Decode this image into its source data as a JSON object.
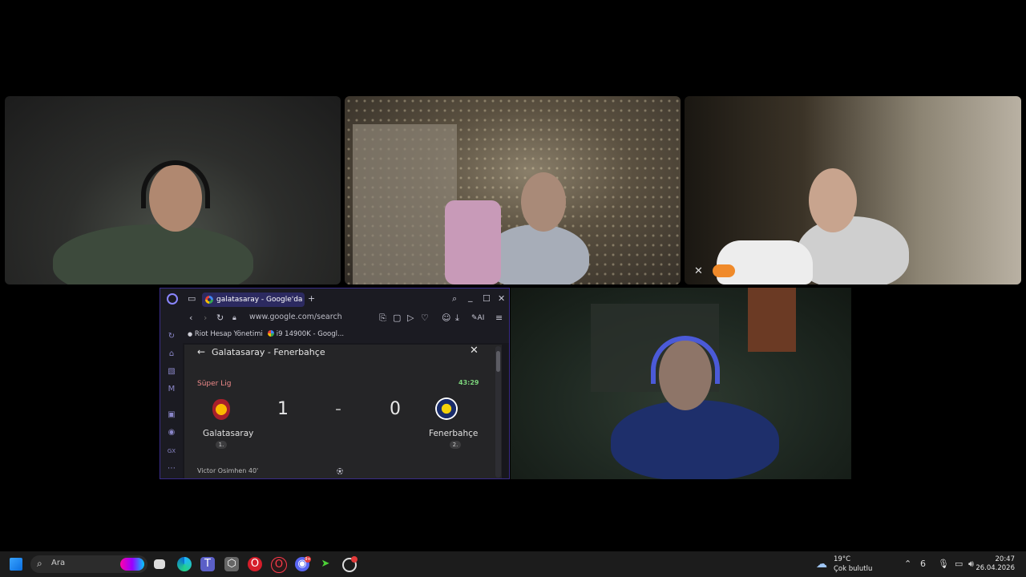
{
  "browser": {
    "tab_title": "galatasaray - Google'da Ara",
    "url": "www.google.com/search",
    "ai_label": "AI",
    "bookmarks": [
      "Riot Hesap Yönetimi",
      "i9 14900K - Googl..."
    ],
    "sidebar_labels": [
      "GX"
    ]
  },
  "match": {
    "title": "Galatasaray - Fenerbahçe",
    "league": "Süper Lig",
    "time": "43:29",
    "home": {
      "name": "Galatasaray",
      "score": "1",
      "rank": "1."
    },
    "away": {
      "name": "Fenerbahçe",
      "score": "0",
      "rank": "2."
    },
    "separator": "-",
    "scorer": "Victor Osimhen 40'"
  },
  "taskbar": {
    "search_placeholder": "Ara",
    "weather_temp": "19°C",
    "weather_desc": "Çok bulutlu",
    "time": "20:47",
    "date": "26.04.2026",
    "discord_badge": "9+"
  },
  "icons": [
    "opera-logo-icon",
    "tab-switch-icon",
    "search-icon",
    "minimize-icon",
    "maximize-icon",
    "close-icon",
    "back-icon",
    "forward-icon",
    "reload-icon",
    "lock-icon",
    "heart-icon",
    "download-icon",
    "menu-icon",
    "twitch-icon",
    "discord-icon",
    "windows-start-icon",
    "weather-cloud-icon",
    "mic-icon",
    "volume-icon"
  ]
}
